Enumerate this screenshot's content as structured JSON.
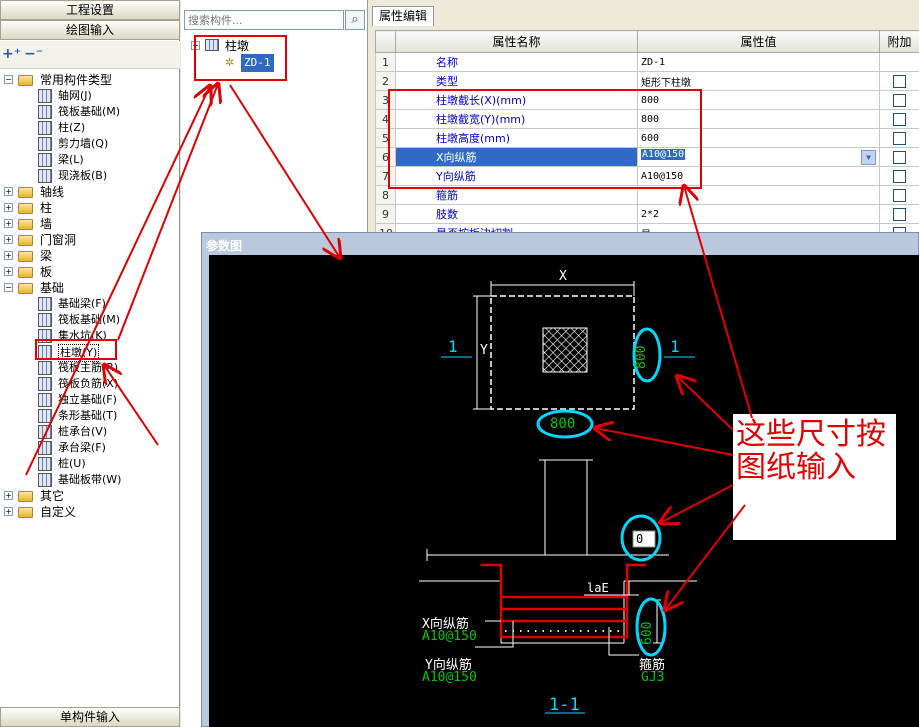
{
  "nav": {
    "project_settings": "工程设置",
    "drawing_input": "绘图输入",
    "single_component_input": "单构件输入"
  },
  "tree": {
    "common_types": "常用构件类型",
    "items": [
      {
        "label": "轴网(J)"
      },
      {
        "label": "筏板基础(M)"
      },
      {
        "label": "柱(Z)"
      },
      {
        "label": "剪力墙(Q)"
      },
      {
        "label": "梁(L)"
      },
      {
        "label": "现浇板(B)"
      }
    ],
    "groups": [
      {
        "label": "轴线"
      },
      {
        "label": "柱"
      },
      {
        "label": "墙"
      },
      {
        "label": "门窗洞"
      },
      {
        "label": "梁"
      },
      {
        "label": "板"
      }
    ],
    "foundation": "基础",
    "foundation_items": [
      {
        "label": "基础梁(F)"
      },
      {
        "label": "筏板基础(M)"
      },
      {
        "label": "集水坑(K)"
      },
      {
        "label": "柱墩(Y)"
      },
      {
        "label": "筏板主筋(R)"
      },
      {
        "label": "筏板负筋(X)"
      },
      {
        "label": "独立基础(F)"
      },
      {
        "label": "条形基础(T)"
      },
      {
        "label": "桩承台(V)"
      },
      {
        "label": "承台梁(F)"
      },
      {
        "label": "桩(U)"
      },
      {
        "label": "基础板带(W)"
      }
    ],
    "others": "其它",
    "custom": "自定义"
  },
  "components": {
    "search_placeholder": "搜索构件...",
    "root": "柱墩",
    "child": "ZD-1"
  },
  "properties": {
    "tab": "属性编辑",
    "col_name": "属性名称",
    "col_value": "属性值",
    "col_attach": "附加",
    "rows": [
      {
        "num": "1",
        "name": "名称",
        "value": "ZD-1"
      },
      {
        "num": "2",
        "name": "类型",
        "value": "矩形下柱墩"
      },
      {
        "num": "3",
        "name": "柱墩截长(X)(mm)",
        "value": "800"
      },
      {
        "num": "4",
        "name": "柱墩截宽(Y)(mm)",
        "value": "800"
      },
      {
        "num": "5",
        "name": "柱墩高度(mm)",
        "value": "600"
      },
      {
        "num": "6",
        "name": "X向纵筋",
        "value": "A10@150"
      },
      {
        "num": "7",
        "name": "Y向纵筋",
        "value": "A10@150"
      },
      {
        "num": "8",
        "name": "箍筋",
        "value": ""
      },
      {
        "num": "9",
        "name": "肢数",
        "value": "2*2"
      },
      {
        "num": "10",
        "name": "是否按板边切割",
        "value": "是"
      }
    ]
  },
  "drawing": {
    "title": "参数图",
    "x_dim": "X",
    "y_dim": "Y",
    "section_mark": "1",
    "x_value": "800",
    "y_value": "800",
    "offset_value": "0",
    "lae": "laE",
    "height_value": "600",
    "x_rebar_label": "X向纵筋",
    "x_rebar_value": "A10@150",
    "y_rebar_label": "Y向纵筋",
    "y_rebar_value": "A10@150",
    "stirrup_label": "箍筋",
    "stirrup_value": "GJ3",
    "section_title": "1-1"
  },
  "annotation": "这些尺寸按图纸输入",
  "colors": {
    "accent_red": "#e00000",
    "cyan": "#00d8ff",
    "green": "#00c800",
    "selection": "#316ac5"
  }
}
